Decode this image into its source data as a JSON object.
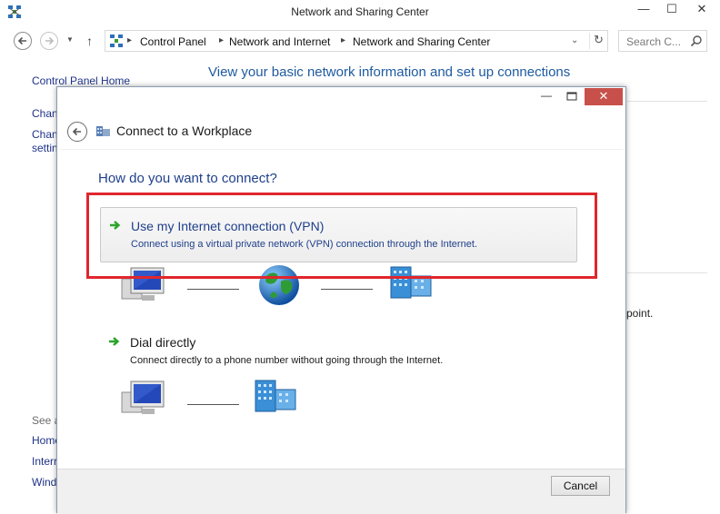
{
  "window": {
    "title": "Network and Sharing Center",
    "min_glyph": "—",
    "max_glyph": "☐",
    "close_glyph": "✕"
  },
  "address_bar": {
    "crumbs": [
      "Control Panel",
      "Network and Internet",
      "Network and Sharing Center"
    ],
    "search_placeholder": "Search C..."
  },
  "background": {
    "control_panel_home": "Control Panel Home",
    "heading": "View your basic network information and set up connections",
    "left_links": [
      "Chan",
      "Chan",
      "settin"
    ],
    "see_also": "See a",
    "bottom_links": [
      "Home",
      "Interr",
      "Wind"
    ],
    "right_fragment": "point."
  },
  "dialog": {
    "title": "Connect to a Workplace",
    "question": "How do you want to connect?",
    "options": [
      {
        "title": "Use my Internet connection (VPN)",
        "description": "Connect using a virtual private network (VPN) connection through the Internet."
      },
      {
        "title": "Dial directly",
        "description": "Connect directly to a phone number without going through the Internet."
      }
    ],
    "cancel_label": "Cancel",
    "close_glyph": "✕",
    "min_glyph": "—"
  },
  "colors": {
    "link_blue": "#1e3f8c",
    "heading_blue": "#1e5aa0",
    "highlight_red": "#e0262d",
    "close_red": "#c7514a",
    "arrow_green": "#2aa52a"
  },
  "icons": [
    "network-center-icon",
    "back-arrow-icon",
    "forward-arrow-icon",
    "up-arrow-icon",
    "refresh-icon",
    "search-icon",
    "workplace-icon",
    "green-arrow-icon",
    "computer-icon",
    "globe-icon",
    "office-building-icon"
  ]
}
